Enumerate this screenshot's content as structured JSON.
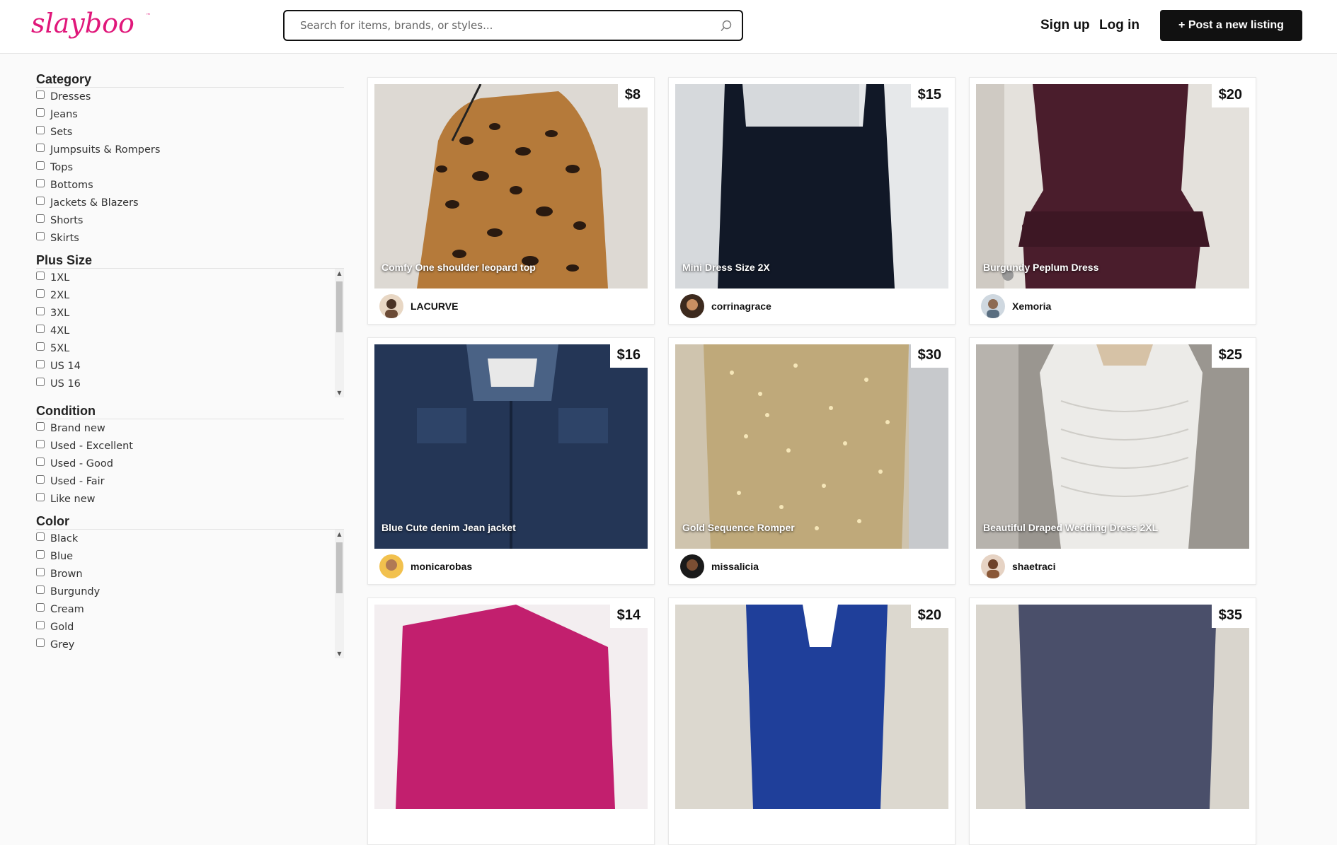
{
  "header": {
    "logo_text": "slayboo",
    "logo_tm": "™",
    "search_placeholder": "Search for items, brands, or styles...",
    "signup": "Sign up",
    "login": "Log in",
    "post_button": "+ Post a new listing"
  },
  "filters": {
    "category": {
      "title": "Category",
      "options": [
        "Dresses",
        "Jeans",
        "Sets",
        "Jumpsuits & Rompers",
        "Tops",
        "Bottoms",
        "Jackets & Blazers",
        "Shorts",
        "Skirts"
      ]
    },
    "plus_size": {
      "title": "Plus Size",
      "options": [
        "1XL",
        "2XL",
        "3XL",
        "4XL",
        "5XL",
        "US 14",
        "US 16"
      ]
    },
    "condition": {
      "title": "Condition",
      "options": [
        "Brand new",
        "Used - Excellent",
        "Used - Good",
        "Used - Fair",
        "Like new"
      ]
    },
    "color": {
      "title": "Color",
      "options": [
        "Black",
        "Blue",
        "Brown",
        "Burgundy",
        "Cream",
        "Gold",
        "Grey"
      ]
    }
  },
  "listings": [
    {
      "title": "Comfy One shoulder leopard top",
      "price": "$8",
      "seller": "LACURVE"
    },
    {
      "title": "Mini Dress Size 2X",
      "price": "$15",
      "seller": "corrinagrace"
    },
    {
      "title": "Burgundy Peplum Dress",
      "price": "$20",
      "seller": "Xemoria"
    },
    {
      "title": "Blue Cute denim Jean jacket",
      "price": "$16",
      "seller": "monicarobas"
    },
    {
      "title": "Gold Sequence Romper",
      "price": "$30",
      "seller": "missalicia"
    },
    {
      "title": "Beautiful Draped Wedding Dress 2XL",
      "price": "$25",
      "seller": "shaetraci"
    },
    {
      "price": "$14"
    },
    {
      "price": "$20"
    },
    {
      "price": "$35"
    }
  ],
  "colors": {
    "brand": "#e0177a",
    "button_bg": "#111111"
  }
}
